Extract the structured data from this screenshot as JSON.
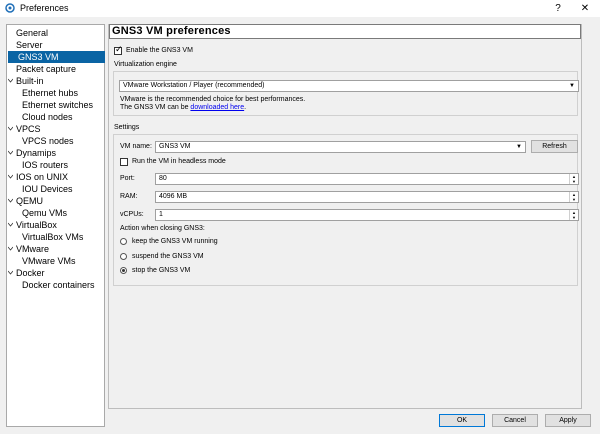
{
  "window": {
    "title": "Preferences",
    "help_glyph": "?",
    "close_glyph": "✕"
  },
  "sidebar": {
    "items": [
      {
        "label": "General"
      },
      {
        "label": "Server"
      },
      {
        "label": "GNS3 VM"
      },
      {
        "label": "Packet capture"
      },
      {
        "label": "Built-in"
      },
      {
        "label": "Ethernet hubs"
      },
      {
        "label": "Ethernet switches"
      },
      {
        "label": "Cloud nodes"
      },
      {
        "label": "VPCS"
      },
      {
        "label": "VPCS nodes"
      },
      {
        "label": "Dynamips"
      },
      {
        "label": "IOS routers"
      },
      {
        "label": "IOS on UNIX"
      },
      {
        "label": "IOU Devices"
      },
      {
        "label": "QEMU"
      },
      {
        "label": "Qemu VMs"
      },
      {
        "label": "VirtualBox"
      },
      {
        "label": "VirtualBox VMs"
      },
      {
        "label": "VMware"
      },
      {
        "label": "VMware VMs"
      },
      {
        "label": "Docker"
      },
      {
        "label": "Docker containers"
      }
    ],
    "selected": "GNS3 VM"
  },
  "panel": {
    "title": "GNS3 VM preferences",
    "enable_label": "Enable the GNS3 VM",
    "enable_checked": true,
    "virt_engine_label": "Virtualization engine",
    "engine_value": "VMware Workstation / Player (recommended)",
    "engine_info_line1": "VMware is the recommended choice for best performances.",
    "engine_info_line2_prefix": "The GNS3 VM can be ",
    "engine_info_link": "downloaded here",
    "engine_info_suffix": ".",
    "settings_label": "Settings",
    "vm_name_label": "VM name:",
    "vm_name_value": "GNS3 VM",
    "refresh_label": "Refresh",
    "headless_label": "Run the VM in headless mode",
    "headless_checked": false,
    "port_label": "Port:",
    "port_value": "80",
    "ram_label": "RAM:",
    "ram_value": "4096 MB",
    "vcpus_label": "vCPUs:",
    "vcpus_value": "1",
    "action_label": "Action when closing GNS3:",
    "radio_keep": "keep the GNS3 VM running",
    "radio_suspend": "suspend the GNS3 VM",
    "radio_stop": "stop the GNS3 VM",
    "selected_action": "stop the GNS3 VM"
  },
  "footer": {
    "ok": "OK",
    "cancel": "Cancel",
    "apply": "Apply"
  },
  "colors": {
    "selection": "#0a64a4",
    "link": "#0000ee"
  },
  "icons": {
    "app": "gns3-logo-icon",
    "expanded": "chevron-down-icon",
    "dropdown": "dropdown-arrow-icon"
  }
}
